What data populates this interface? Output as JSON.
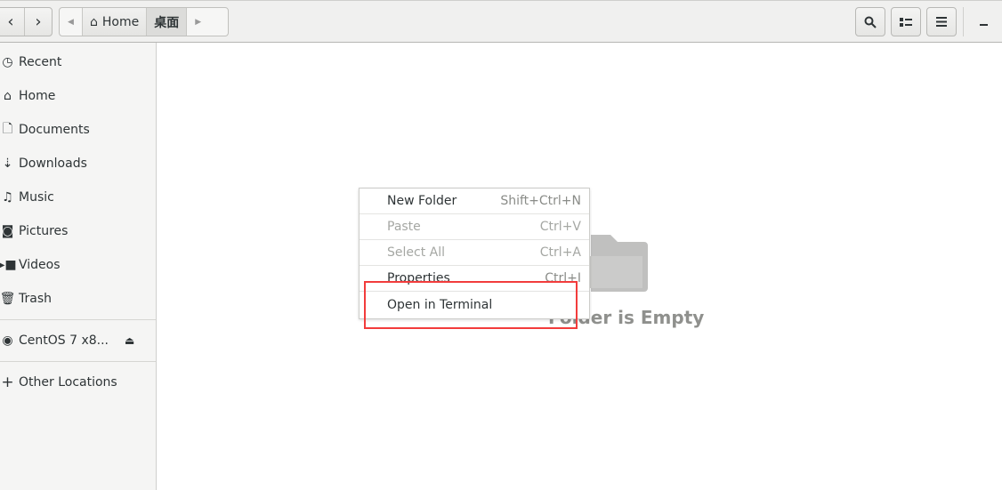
{
  "header": {
    "back_icon": "chevron-left",
    "forward_icon": "chevron-right",
    "breadcrumb": [
      {
        "label": "Home",
        "icon": "home-icon"
      },
      {
        "label": "桌面"
      }
    ],
    "buttons": [
      "search-icon",
      "view-list-icon",
      "menu-icon",
      "minimize-icon"
    ]
  },
  "sidebar": {
    "items": [
      {
        "label": "Recent",
        "icon": "clock"
      },
      {
        "label": "Home",
        "icon": "home"
      },
      {
        "label": "Documents",
        "icon": "document"
      },
      {
        "label": "Downloads",
        "icon": "download"
      },
      {
        "label": "Music",
        "icon": "music"
      },
      {
        "label": "Pictures",
        "icon": "camera"
      },
      {
        "label": "Videos",
        "icon": "video"
      },
      {
        "label": "Trash",
        "icon": "trash"
      }
    ],
    "devices": [
      {
        "label": "CentOS 7 x8...",
        "icon": "disc",
        "eject": "eject-icon"
      }
    ],
    "other": {
      "label": "Other Locations",
      "icon": "plus"
    }
  },
  "main": {
    "empty_text": "Folder is Empty"
  },
  "context_menu": {
    "items": [
      {
        "label": "New Folder",
        "accel": "Shift+Ctrl+N",
        "enabled": true
      },
      {
        "label": "Paste",
        "accel": "Ctrl+V",
        "enabled": false
      },
      {
        "label": "Select All",
        "accel": "Ctrl+A",
        "enabled": false
      },
      {
        "label": "Properties",
        "accel": "Ctrl+I",
        "enabled": true
      },
      {
        "label": "Open in Terminal",
        "accel": "",
        "enabled": true
      }
    ]
  },
  "highlight_color": "#f23c3c"
}
